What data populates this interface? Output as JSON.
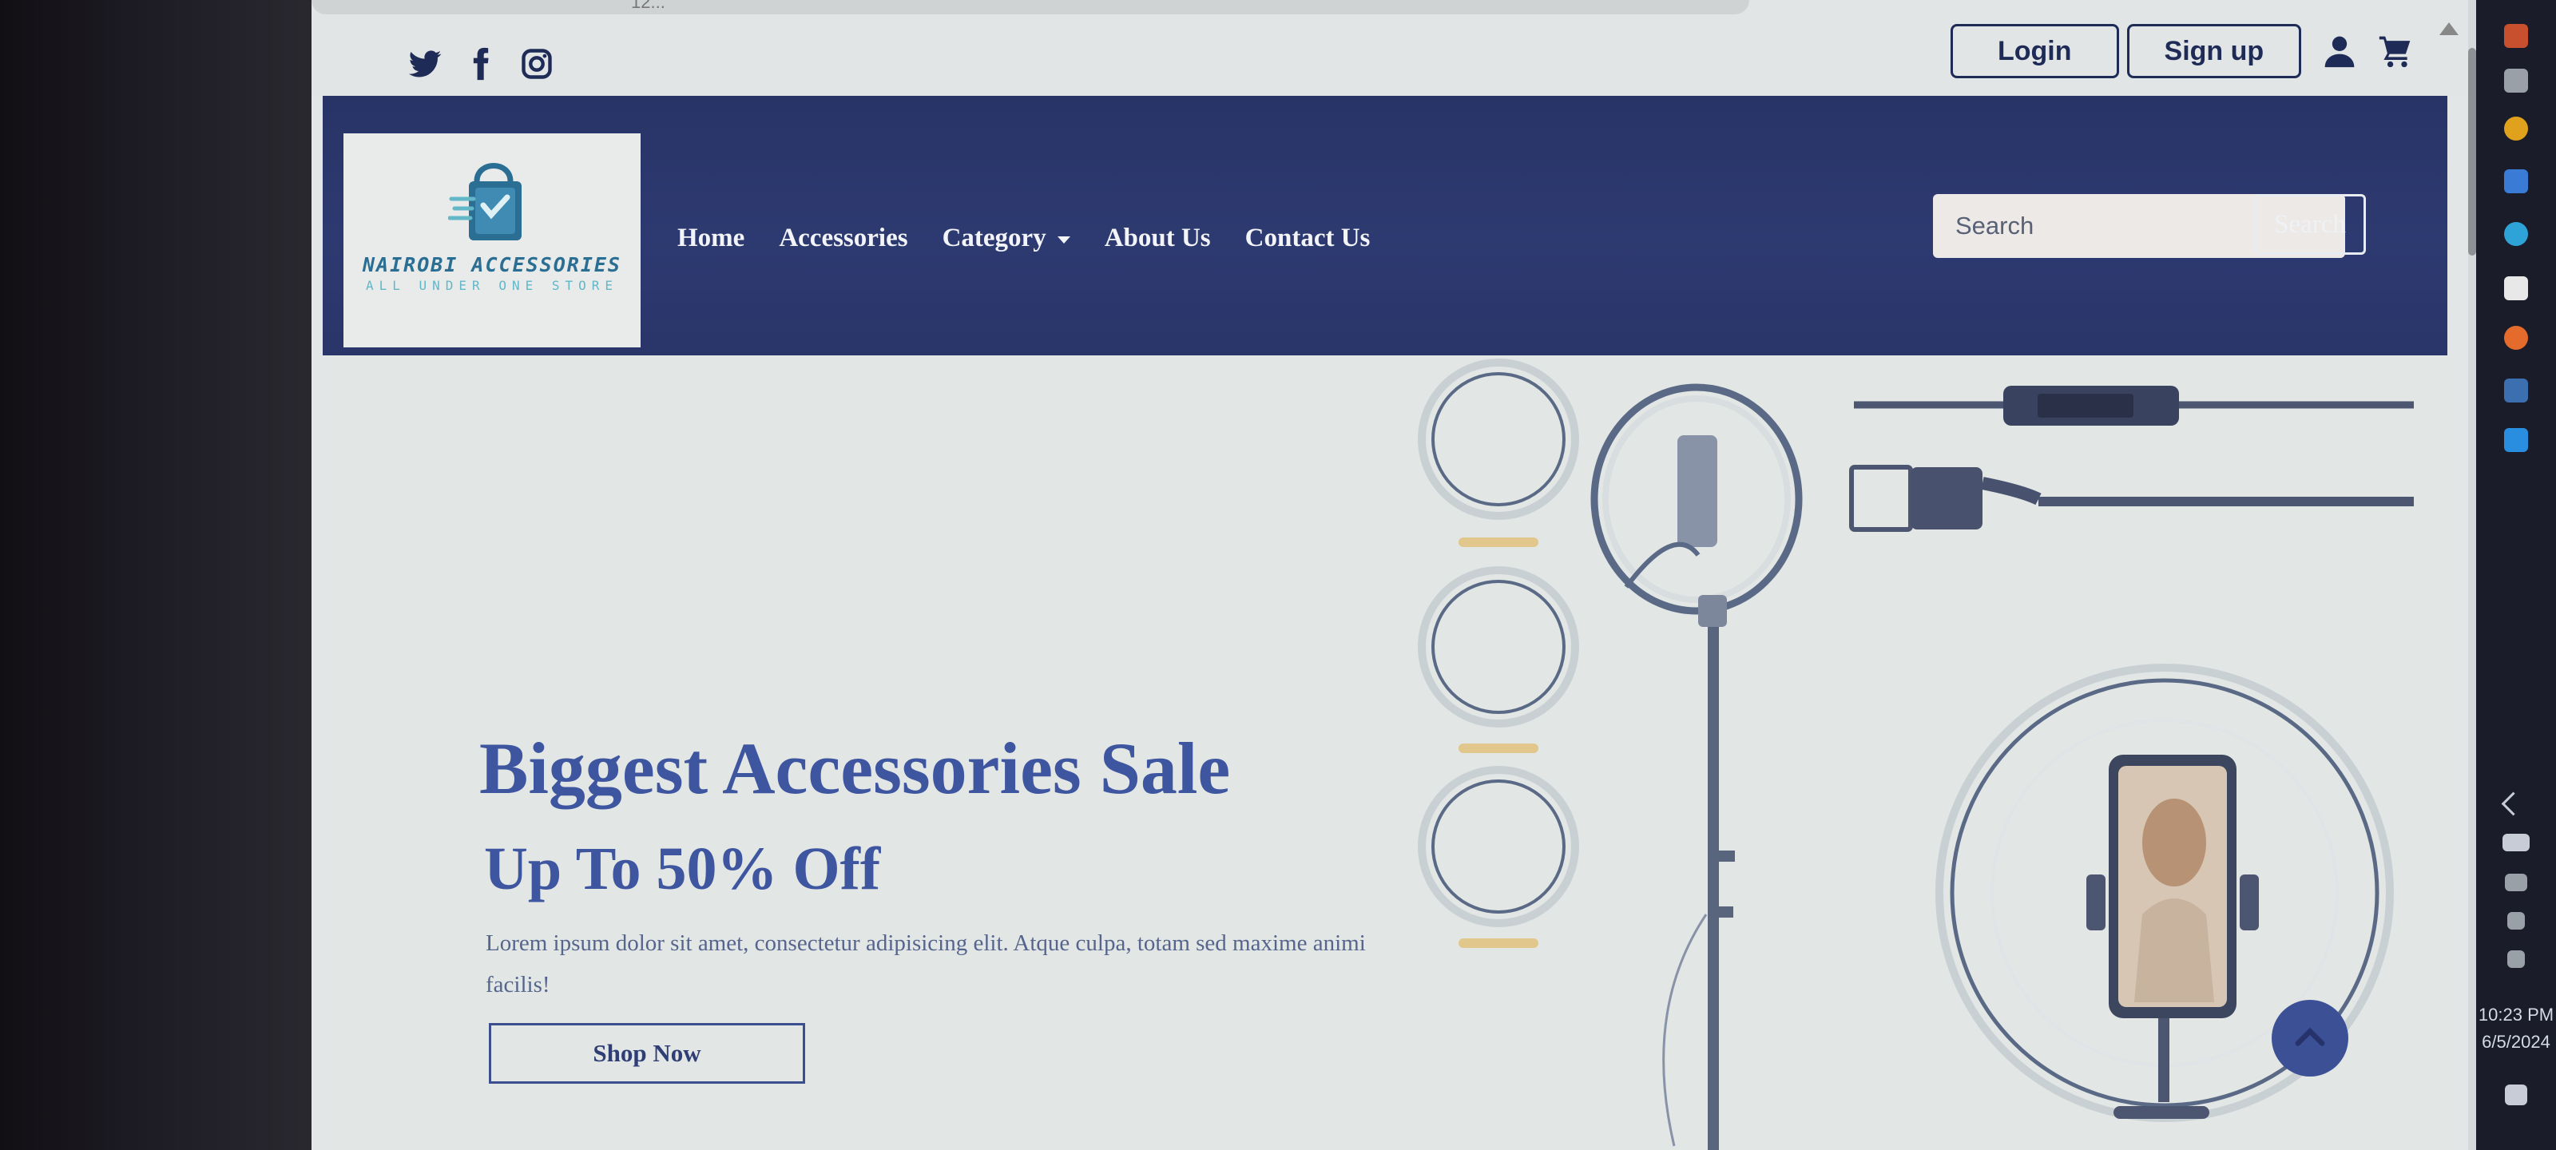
{
  "browser": {
    "url_fragment": "12..."
  },
  "topbar": {
    "social_icons": [
      "twitter-icon",
      "facebook-icon",
      "instagram-icon"
    ],
    "login_label": "Login",
    "signup_label": "Sign up",
    "user_icon": "user-icon",
    "cart_icon": "cart-icon"
  },
  "navbar": {
    "logo": {
      "brand": "NAIROBI ACCESSORIES",
      "tagline": "ALL UNDER ONE STORE"
    },
    "links": [
      "Home",
      "Accessories",
      "Category",
      "About Us",
      "Contact Us"
    ],
    "search_placeholder": "Search",
    "search_button": "Search"
  },
  "hero": {
    "title": "Biggest Accessories Sale",
    "subtitle": "Up To 50% Off",
    "description": "Lorem ipsum dolor sit amet, consectetur adipisicing elit. Atque culpa, totam sed maxime animi facilis!",
    "cta_label": "Shop Now"
  },
  "taskbar": {
    "time": "10:23 PM",
    "date": "6/5/2024"
  },
  "colors": {
    "primary_navy": "#2d3a71",
    "hero_text": "#3e55a0",
    "page_bg": "#e3e6e6",
    "logo_teal": "#2b6e93"
  }
}
